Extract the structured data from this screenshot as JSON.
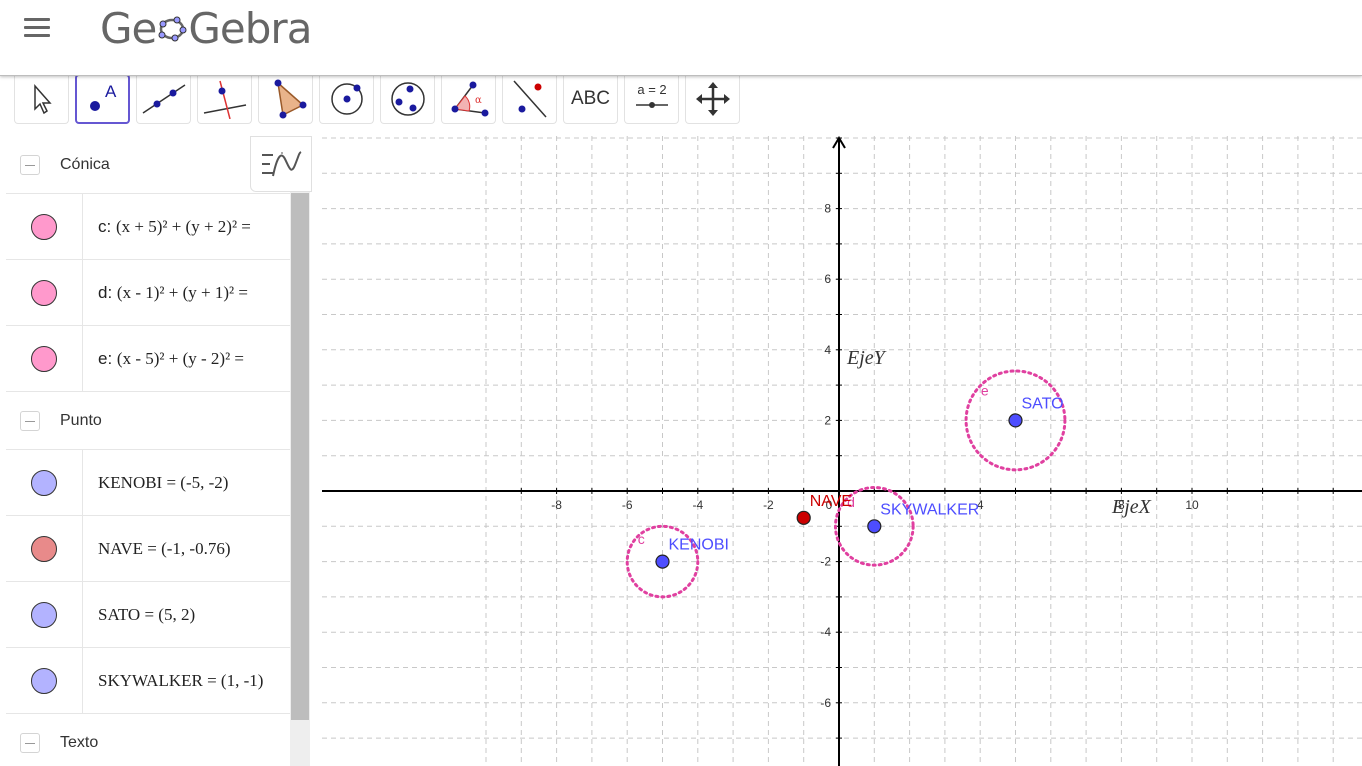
{
  "app": {
    "logo_text_left": "Ge",
    "logo_text_right": "Gebra"
  },
  "toolbar": {
    "tools": [
      {
        "name": "move-tool",
        "icon": "cursor-arrow-icon"
      },
      {
        "name": "point-tool",
        "icon": "point-A-icon",
        "active": true
      },
      {
        "name": "line-tool",
        "icon": "line-through-points-icon"
      },
      {
        "name": "perpendicular-tool",
        "icon": "perpendicular-line-icon"
      },
      {
        "name": "polygon-tool",
        "icon": "polygon-icon"
      },
      {
        "name": "circle-center-point-tool",
        "icon": "circle-center-icon"
      },
      {
        "name": "circle-three-points-tool",
        "icon": "circle-three-points-icon"
      },
      {
        "name": "angle-tool",
        "icon": "angle-icon"
      },
      {
        "name": "reflect-tool",
        "icon": "reflect-point-icon"
      },
      {
        "name": "text-tool",
        "label": "ABC"
      },
      {
        "name": "slider-tool",
        "label": "a = 2"
      },
      {
        "name": "move-graphics-tool",
        "icon": "move-arrows-icon"
      }
    ]
  },
  "algebra": {
    "groups": [
      {
        "label": "Cónica",
        "items": [
          {
            "name": "c",
            "expr": "(x + 5)² + (y + 2)² =",
            "color": "#ff99cc"
          },
          {
            "name": "d",
            "expr": "(x - 1)² + (y + 1)² =",
            "color": "#ff99cc"
          },
          {
            "name": "e",
            "expr": "(x - 5)² + (y - 2)² =",
            "color": "#ff99cc"
          }
        ]
      },
      {
        "label": "Punto",
        "items": [
          {
            "text": "KENOBI = (-5, -2)",
            "color": "#b3b3ff"
          },
          {
            "text": "NAVE = (-1, -0.76)",
            "color": "#e88a8a"
          },
          {
            "text": "SATO = (5, 2)",
            "color": "#b3b3ff"
          },
          {
            "text": "SKYWALKER = (1, -1)",
            "color": "#b3b3ff"
          }
        ]
      },
      {
        "label": "Texto",
        "items": []
      }
    ]
  },
  "graphics": {
    "x_ticks": [
      "-8",
      "-6",
      "-4",
      "-2",
      "0",
      "4",
      "8",
      "10"
    ],
    "y_ticks": [
      "8",
      "6",
      "4",
      "2",
      "-2",
      "-4",
      "-6"
    ],
    "x_axis_label": "EjeX",
    "y_axis_label": "EjeY",
    "points": [
      {
        "label": "KENOBI",
        "x": -5,
        "y": -2,
        "color": "#4d4dff"
      },
      {
        "label": "NAVE",
        "x": -1,
        "y": -0.76,
        "color": "#cc0000"
      },
      {
        "label": "SATO",
        "x": 5,
        "y": 2,
        "color": "#4d4dff"
      },
      {
        "label": "SKYWALKER",
        "x": 1,
        "y": -1,
        "color": "#4d4dff"
      }
    ],
    "conics": [
      {
        "label": "c",
        "cx": -5,
        "cy": -2,
        "r": 1
      },
      {
        "label": "d",
        "cx": 1,
        "cy": -1,
        "r": 1.1
      },
      {
        "label": "e",
        "cx": 5,
        "cy": 2,
        "r": 1.4
      }
    ],
    "conic_color": "#e040a0"
  }
}
